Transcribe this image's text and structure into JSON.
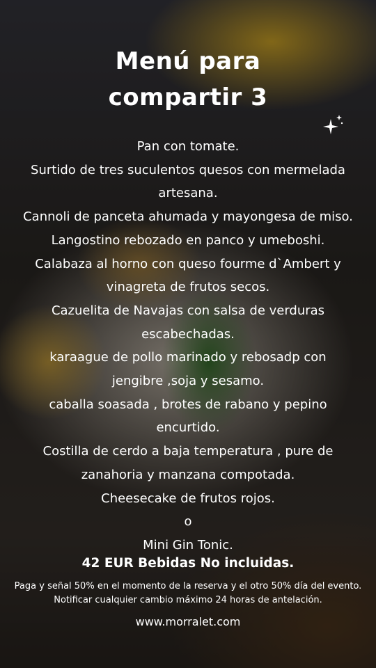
{
  "title": {
    "line1": "Menú para",
    "line2": "compartir 3"
  },
  "menu": {
    "items": [
      "Pan con tomate.",
      "Surtido de tres suculentos quesos con mermelada",
      "artesana.",
      "Cannoli de panceta ahumada y mayongesa de miso.",
      "Langostino rebozado en panco y umeboshi.",
      "Calabaza al horno con queso fourme d`Ambert y",
      "vinagreta de frutos secos.",
      "Cazuelita de Navajas con salsa de verduras",
      "escabechadas.",
      "karaague de pollo marinado y rebosadp con",
      "jengibre ,soja y sesamo.",
      "caballa soasada ,  brotes de rabano y pepino",
      "encurtido.",
      "Costilla de cerdo a baja temperatura , pure de",
      "zanahoria y manzana compotada.",
      "Cheesecake de frutos rojos.",
      "o",
      "Mini Gin Tonic."
    ]
  },
  "price": "42 EUR Bebidas No incluidas.",
  "note": {
    "line1": "Paga y señal 50% en el momento de la reserva y el otro 50% día del evento.",
    "line2": "Notificar cualquier cambio máximo 24 horas de antelación."
  },
  "website": "www.morralet.com",
  "decor": {
    "sparkle_icon": "sparkle-icon",
    "text_color": "#ffffff"
  }
}
